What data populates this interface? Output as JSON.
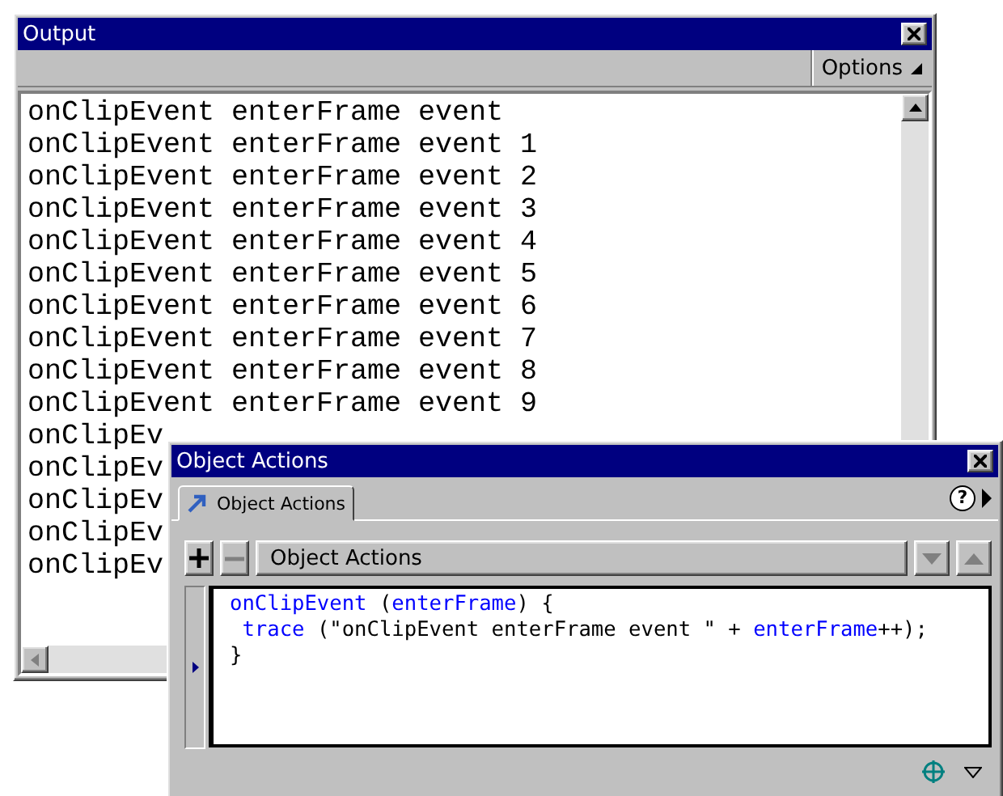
{
  "output": {
    "title": "Output",
    "options_label": "Options",
    "lines": [
      "onClipEvent enterFrame event",
      "onClipEvent enterFrame event 1",
      "onClipEvent enterFrame event 2",
      "onClipEvent enterFrame event 3",
      "onClipEvent enterFrame event 4",
      "onClipEvent enterFrame event 5",
      "onClipEvent enterFrame event 6",
      "onClipEvent enterFrame event 7",
      "onClipEvent enterFrame event 8",
      "onClipEvent enterFrame event 9",
      "onClipEv",
      "onClipEv",
      "onClipEv",
      "onClipEv",
      "onClipEv"
    ]
  },
  "actions": {
    "title": "Object Actions",
    "tabs": [
      {
        "label": "Object Actions",
        "selected": true
      }
    ],
    "help": "?",
    "tools": [
      {
        "kind": "add",
        "disabled": false
      },
      {
        "kind": "remove",
        "disabled": true
      }
    ],
    "dropdown": "Object Actions",
    "arrows": [
      {
        "kind": "down",
        "disabled": true
      },
      {
        "kind": "up",
        "disabled": true
      }
    ],
    "code": [
      [
        {
          "text": "onClipEvent",
          "kind": "keyword"
        },
        {
          "text": " (",
          "kind": "plain"
        },
        {
          "text": "enterFrame",
          "kind": "keyword"
        },
        {
          "text": ") {",
          "kind": "plain"
        }
      ],
      [
        {
          "text": " trace",
          "kind": "keyword"
        },
        {
          "text": " (\"onClipEvent enterFrame event \" + ",
          "kind": "plain"
        },
        {
          "text": "enterFrame",
          "kind": "keyword"
        },
        {
          "text": "++);",
          "kind": "plain"
        }
      ],
      [
        {
          "text": "}",
          "kind": "plain"
        }
      ]
    ]
  }
}
